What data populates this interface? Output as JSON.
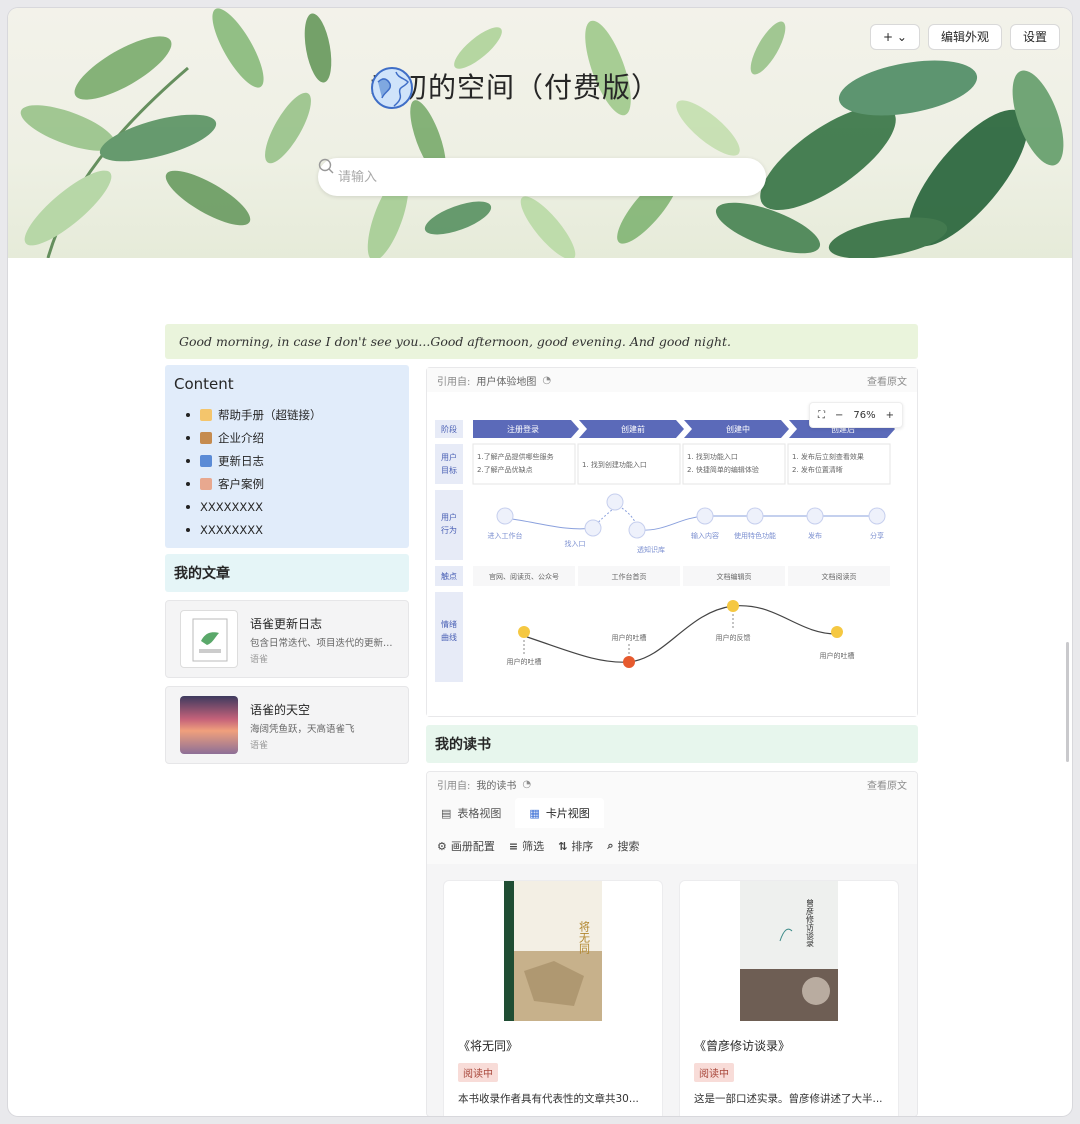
{
  "header": {
    "title": "季初的空间（付费版）",
    "add_label": "+ ⌄",
    "edit_appearance": "编辑外观",
    "settings": "设置",
    "search_placeholder": "请输入"
  },
  "quote": "Good morning, in case I don't see you...Good afternoon, good evening. And good night.",
  "content_card": {
    "title": "Content",
    "items": [
      "帮助手册（超链接）",
      "企业介绍",
      "更新日志",
      "客户案例",
      "XXXXXXXX",
      "XXXXXXXX"
    ]
  },
  "articles": {
    "heading": "我的文章",
    "list": [
      {
        "title": "语雀更新日志",
        "desc": "包含日常迭代、项目迭代的更新内...",
        "source": "语雀"
      },
      {
        "title": "语雀的天空",
        "desc": "海阔凭鱼跃，天高语雀飞",
        "source": "语雀"
      }
    ]
  },
  "journey_embed": {
    "ref_prefix": "引用自:",
    "ref_name": "用户体验地图",
    "view_original": "查看原文",
    "zoom": "76%",
    "zoom_minus": "−",
    "zoom_plus": "+",
    "rows": [
      "阶段",
      "用户\n目标",
      "用户\n行为",
      "触点",
      "情绪\n曲线"
    ],
    "stages": [
      "注册登录",
      "创建前",
      "创建中",
      "创建后"
    ],
    "goals": [
      [
        "1.了解产品提供哪些服务",
        "2.了解产品优缺点"
      ],
      [
        "1. 找到创建功能入口"
      ],
      [
        "1. 找到功能入口",
        "2. 快捷简单的编辑体验"
      ],
      [
        "1. 发布后立刻查看效果",
        "2. 发布位置清晰"
      ]
    ],
    "actions": [
      "进入工作台",
      "找入口",
      "透知识库",
      "输入内容",
      "使用特色功能",
      "发布",
      "分享"
    ],
    "touchpoints": [
      "官网、阅读页、公众号",
      "工作台首页",
      "文档编辑页",
      "文档阅读页"
    ],
    "emotions": [
      "用户的吐槽",
      "用户的吐槽",
      "用户的反馈",
      "用户的吐槽"
    ]
  },
  "reading": {
    "heading": "我的读书",
    "ref_prefix": "引用自:",
    "ref_name": "我的读书",
    "view_original": "查看原文",
    "tabs": [
      "表格视图",
      "卡片视图"
    ],
    "toolbar": [
      "画册配置",
      "筛选",
      "排序",
      "搜索"
    ],
    "books": [
      {
        "title": "《将无同》",
        "status": "阅读中",
        "desc": "本书收录作者具有代表性的文章共30...",
        "cover_text": "将无同"
      },
      {
        "title": "《曾彦修访谈录》",
        "status": "阅读中",
        "desc": "这是一部口述实录。曾彦修讲述了大半...",
        "cover_text": "曾彦修访谈录"
      }
    ]
  },
  "colors": {
    "stage_blue": "#5b6ab9",
    "quote_bg": "#eaf4dc",
    "content_bg": "#e1ecfa"
  }
}
